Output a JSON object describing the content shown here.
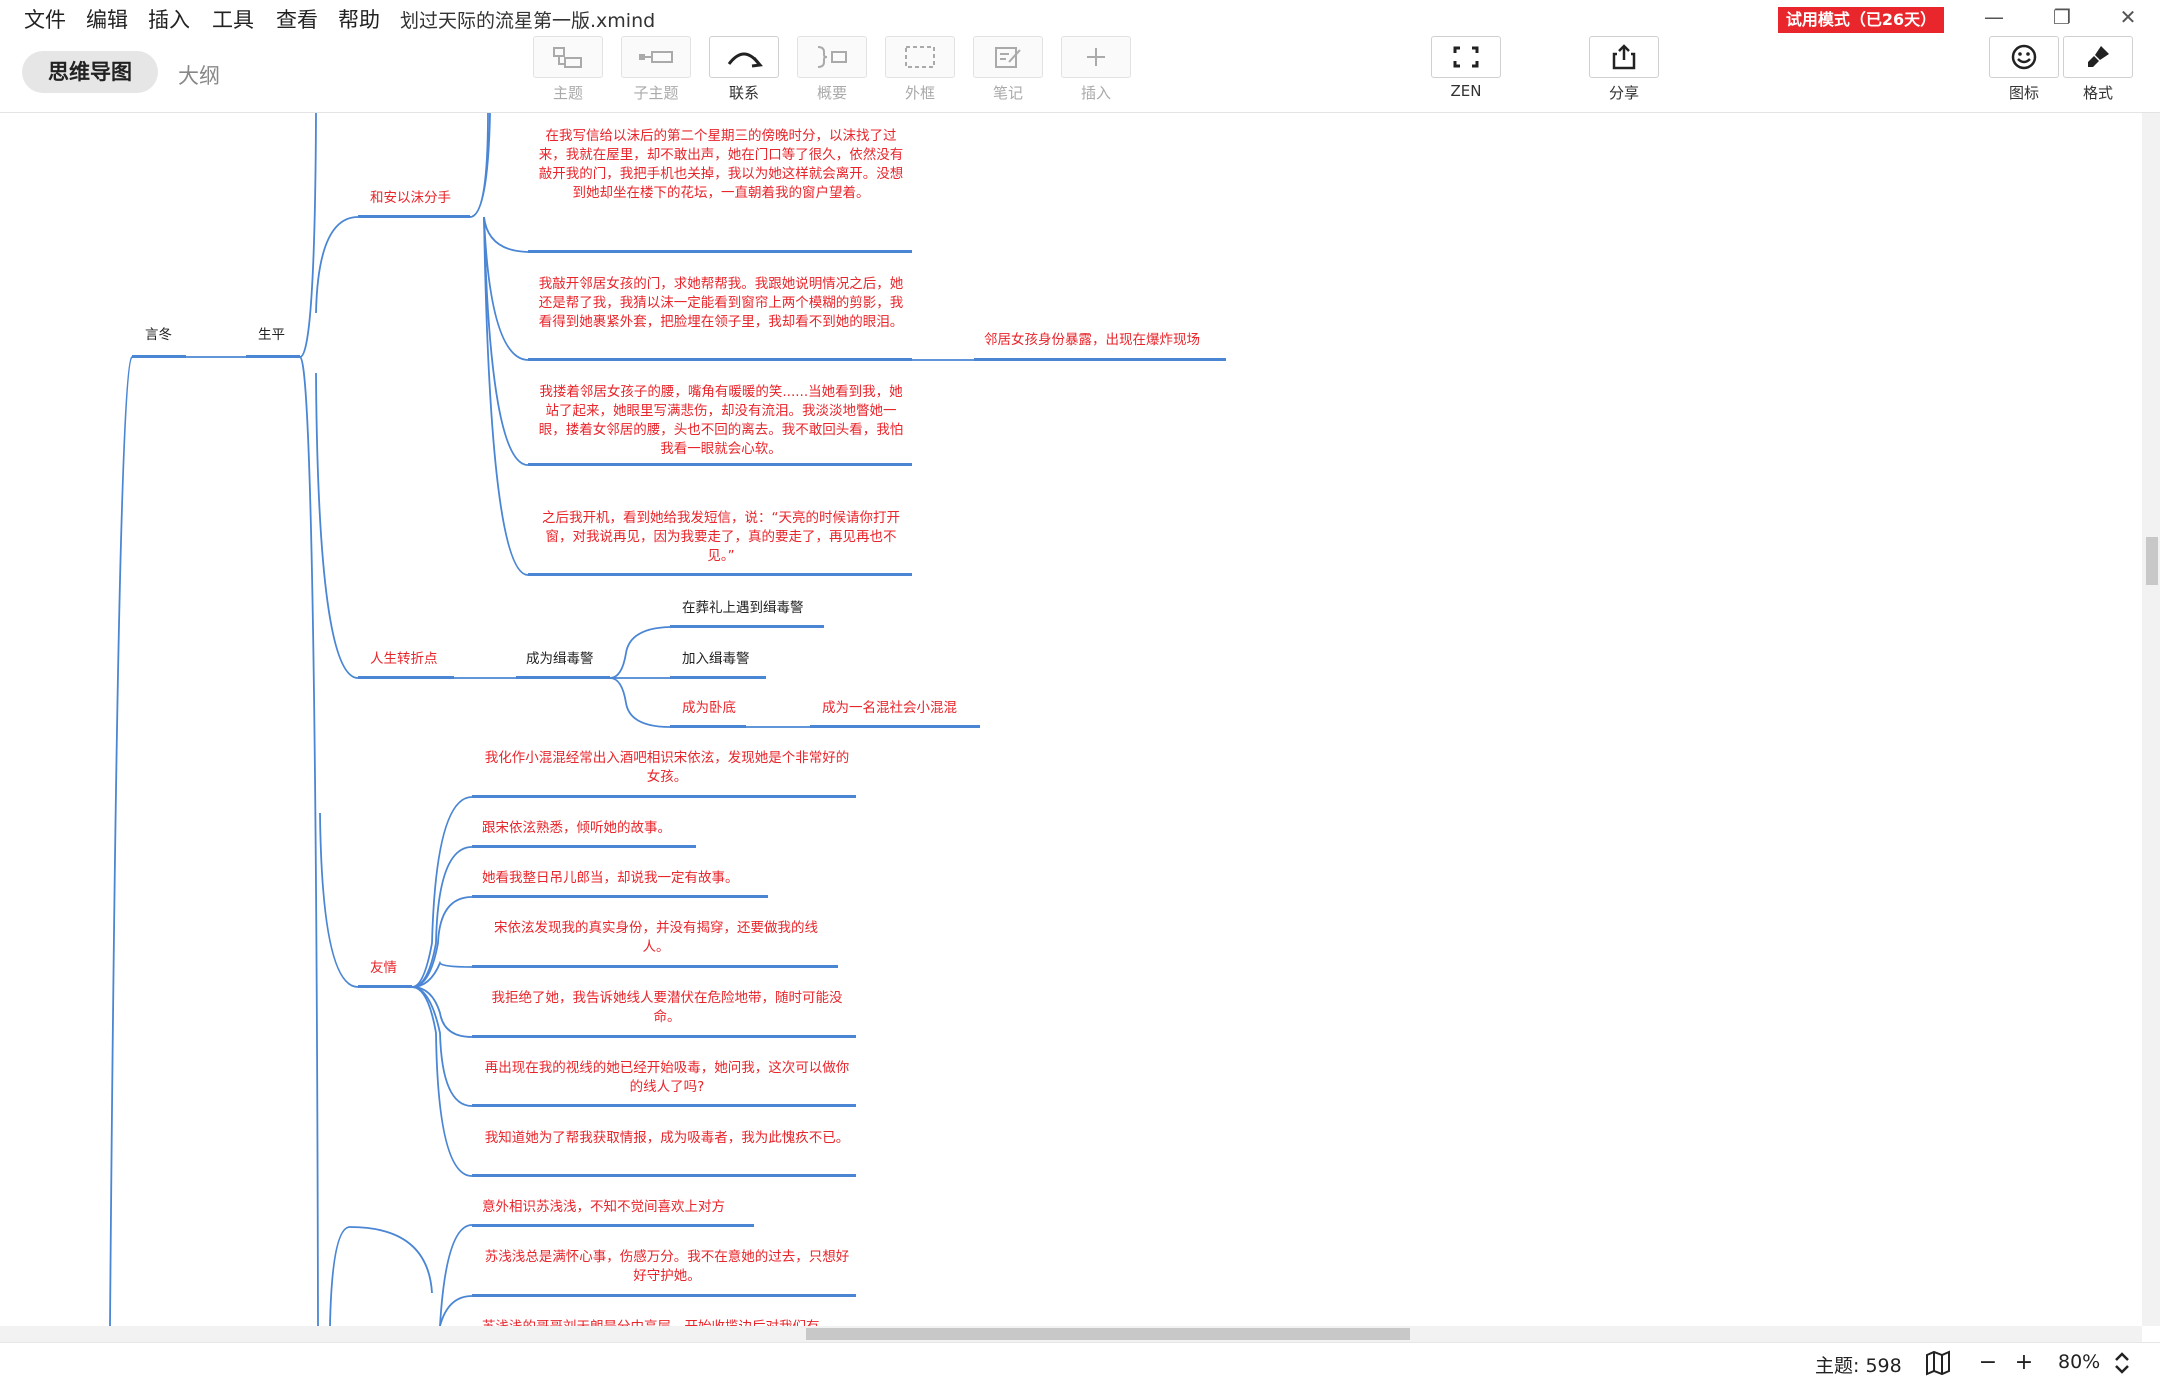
{
  "menu": {
    "items": [
      "文件",
      "编辑",
      "插入",
      "工具",
      "查看",
      "帮助"
    ],
    "doc_title": "划过天际的流星第一版.xmind",
    "trial": "试用模式（已26天）"
  },
  "toolbar": {
    "view_mindmap": "思维导图",
    "view_outline": "大纲",
    "tools": [
      {
        "label": "主题",
        "icon": "topic-icon"
      },
      {
        "label": "子主题",
        "icon": "subtopic-icon"
      },
      {
        "label": "联系",
        "icon": "relationship-icon"
      },
      {
        "label": "概要",
        "icon": "summary-icon"
      },
      {
        "label": "外框",
        "icon": "boundary-icon"
      },
      {
        "label": "笔记",
        "icon": "note-icon"
      },
      {
        "label": "插入",
        "icon": "insert-icon"
      }
    ],
    "zen": "ZEN",
    "share": "分享",
    "icons_panel": "图标",
    "format_panel": "格式"
  },
  "mindmap": {
    "root_left": "言冬",
    "shengping": "生平",
    "breakup": {
      "title": "和安以沫分手",
      "notes": [
        "在我写信给以沫后的第二个星期三的傍晚时分，以沫找了过来，我就在屋里，却不敢出声，她在门口等了很久，依然没有敲开我的门，我把手机也关掉，我以为她这样就会离开。没想到她却坐在楼下的花坛，一直朝着我的窗户望着。",
        "我敲开邻居女孩的门，求她帮帮我。我跟她说明情况之后，她还是帮了我，我猜以沫一定能看到窗帘上两个模糊的剪影，我看得到她裹紧外套，把脸埋在领子里，我却看不到她的眼泪。",
        "我搂着邻居女孩子的腰，嘴角有暖暖的笑......当她看到我，她站了起来，她眼里写满悲伤，却没有流泪。我淡淡地瞥她一眼，搂着女邻居的腰，头也不回的离去。我不敢回头看，我怕我看一眼就会心软。",
        "之后我开机，看到她给我发短信，说：“天亮的时候请你打开窗，对我说再见，因为我要走了，真的要走了，再见再也不见。”"
      ],
      "neighbor_note": "邻居女孩身份暴露，出现在爆炸现场"
    },
    "turning_point": {
      "title": "人生转折点",
      "undercover": "成为缉毒警",
      "children": [
        "在葬礼上遇到缉毒警",
        "加入缉毒警",
        "成为卧底"
      ],
      "gangster": "成为一名混社会小混混"
    },
    "friendship": {
      "title": "友情",
      "items": [
        "我化作小混混经常出入酒吧相识宋依泫，发现她是个非常好的女孩。",
        "跟宋依泫熟悉，倾听她的故事。",
        "她看我整日吊儿郎当，却说我一定有故事。",
        "宋依泫发现我的真实身份，并没有揭穿，还要做我的线人。",
        "我拒绝了她，我告诉她线人要潜伏在危险地带，随时可能没命。",
        "再出现在我的视线的她已经开始吸毒，她问我，这次可以做你的线人了吗?",
        "我知道她为了帮我获取情报，成为吸毒者，我为此愧疚不已。"
      ]
    },
    "love": {
      "items": [
        "意外相识苏浅浅，不知不觉间喜欢上对方",
        "苏浅浅总是满怀心事，伤感万分。我不在意她的过去，只想好好守护她。",
        "苏浅浅的哥哥刘天朗是分中高层，开始收揽边后对我们有"
      ]
    }
  },
  "status": {
    "topic_count": "主题: 598",
    "zoom": "80%"
  }
}
